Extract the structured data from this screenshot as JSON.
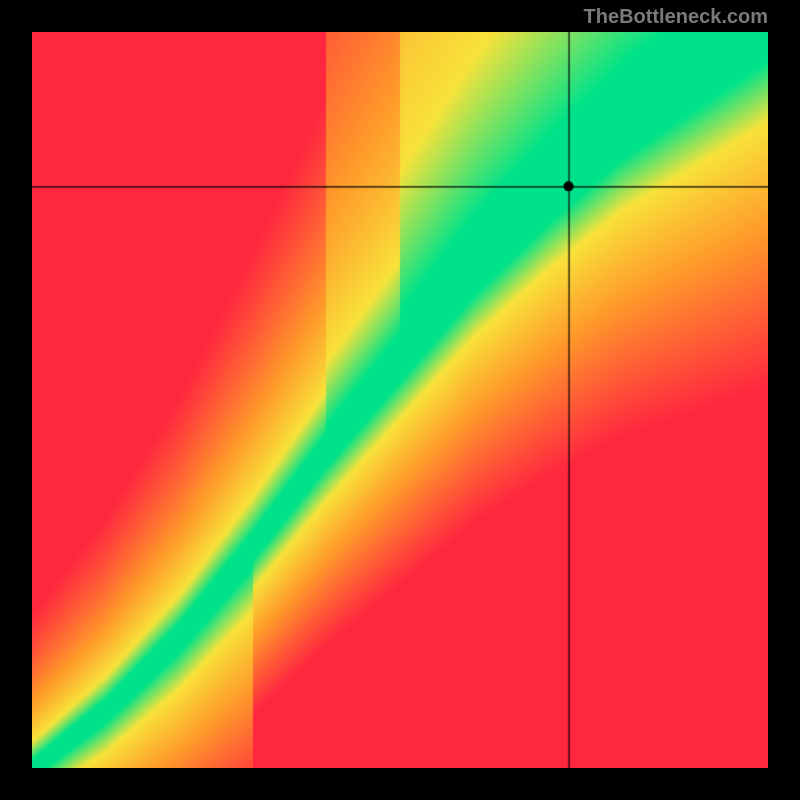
{
  "watermark": "TheBottleneck.com",
  "chart_data": {
    "type": "heatmap",
    "title": "",
    "xlabel": "",
    "ylabel": "",
    "xlim": [
      0,
      100
    ],
    "ylim": [
      0,
      100
    ],
    "crosshair": {
      "x": 73,
      "y": 79
    },
    "marker": {
      "x": 73,
      "y": 79
    },
    "legend": "none",
    "description": "2D gradient field: green ridge along a curved diagonal (bottom-left to top-right), transitioning through yellow/orange to red toward the top-left and bottom-right corners. Black crosshair lines at x≈73 and y≈79 with a black dot at the intersection.",
    "colors": {
      "ridge": "#00e28a",
      "mid": "#f8e23a",
      "warm": "#ff9a2a",
      "hot": "#ff263f",
      "background": "#000000",
      "crosshair": "#000000",
      "marker": "#000000"
    },
    "ridge_curve_xy": [
      [
        0,
        0
      ],
      [
        10,
        8
      ],
      [
        20,
        18
      ],
      [
        30,
        30
      ],
      [
        40,
        43
      ],
      [
        50,
        55
      ],
      [
        60,
        67
      ],
      [
        70,
        77
      ],
      [
        80,
        86
      ],
      [
        90,
        93
      ],
      [
        100,
        100
      ]
    ],
    "green_band_halfwidth": 4
  }
}
